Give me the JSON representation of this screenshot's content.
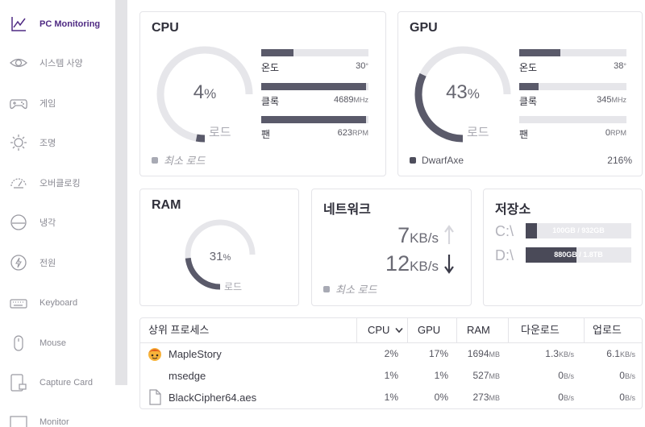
{
  "sidebar": {
    "items": [
      {
        "label": "PC Monitoring",
        "icon": "chart-line-icon",
        "active": true
      },
      {
        "label": "시스템 사양",
        "icon": "eye-icon"
      },
      {
        "label": "게임",
        "icon": "gamepad-icon"
      },
      {
        "label": "조명",
        "icon": "sun-icon"
      },
      {
        "label": "오버클로킹",
        "icon": "speedometer-icon"
      },
      {
        "label": "냉각",
        "icon": "cooling-icon"
      },
      {
        "label": "전원",
        "icon": "power-icon"
      },
      {
        "label": "Keyboard",
        "icon": "keyboard-icon"
      },
      {
        "label": "Mouse",
        "icon": "mouse-icon"
      },
      {
        "label": "Capture Card",
        "icon": "capture-card-icon"
      },
      {
        "label": "Monitor",
        "icon": "monitor-icon"
      }
    ]
  },
  "cpu": {
    "title": "CPU",
    "load_value": "4",
    "load_unit": "%",
    "load_fraction": 0.04,
    "load_label": "로드",
    "bars": [
      {
        "label": "온도",
        "value": "30",
        "unit": "°",
        "fraction": 0.3
      },
      {
        "label": "클록",
        "value": "4689",
        "unit": "MHz",
        "fraction": 0.98
      },
      {
        "label": "팬",
        "value": "623",
        "unit": "RPM",
        "fraction": 0.98
      }
    ],
    "legend": "최소 로드"
  },
  "gpu": {
    "title": "GPU",
    "load_value": "43",
    "load_unit": "%",
    "load_fraction": 0.43,
    "load_label": "로드",
    "bars": [
      {
        "label": "온도",
        "value": "38",
        "unit": "°",
        "fraction": 0.38
      },
      {
        "label": "클록",
        "value": "345",
        "unit": "MHz",
        "fraction": 0.18
      },
      {
        "label": "팬",
        "value": "0",
        "unit": "RPM",
        "fraction": 0.0
      }
    ],
    "legend": "DwarfAxe",
    "legend_value": "216%"
  },
  "ram": {
    "title": "RAM",
    "load_value": "31",
    "load_unit": "%",
    "load_fraction": 0.31,
    "load_label": "로드"
  },
  "network": {
    "title": "네트워크",
    "upload_value": "7",
    "upload_unit": "KB/s",
    "download_value": "12",
    "download_unit": "KB/s",
    "legend": "최소 로드"
  },
  "storage": {
    "title": "저장소",
    "drives": [
      {
        "letter": "C:\\",
        "text": "100GB / 932GB",
        "fraction": 0.107
      },
      {
        "letter": "D:\\",
        "text": "880GB / 1.8TB",
        "fraction": 0.48
      }
    ]
  },
  "processes": {
    "headers": {
      "name": "상위 프로세스",
      "cpu": "CPU",
      "gpu": "GPU",
      "ram": "RAM",
      "download": "다운로드",
      "upload": "업로드"
    },
    "rows": [
      {
        "name": "MapleStory",
        "icon": "maplestory-app-icon",
        "cpu": "2%",
        "gpu": "17%",
        "ram": "1694",
        "ram_unit": "MB",
        "down": "1.3",
        "down_unit": "KB/s",
        "up": "6.1",
        "up_unit": "KB/s"
      },
      {
        "name": "msedge",
        "icon": "",
        "cpu": "1%",
        "gpu": "1%",
        "ram": "527",
        "ram_unit": "MB",
        "down": "0",
        "down_unit": "B/s",
        "up": "0",
        "up_unit": "B/s"
      },
      {
        "name": "BlackCipher64.aes",
        "icon": "file-icon",
        "cpu": "1%",
        "gpu": "0%",
        "ram": "273",
        "ram_unit": "MB",
        "down": "0",
        "down_unit": "B/s",
        "up": "0",
        "up_unit": "B/s"
      }
    ]
  },
  "colors": {
    "accent": "#4f2a83",
    "gauge_fill": "#5a5a6a",
    "gauge_track": "#e6e6ea"
  }
}
